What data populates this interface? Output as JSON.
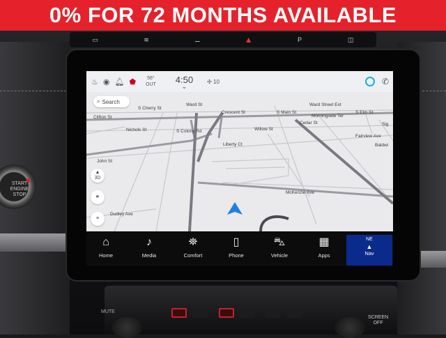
{
  "banner": {
    "text": "0% FOR 72 MONTHS AVAILABLE"
  },
  "status_bar": {
    "temp_value": "56°",
    "temp_label": "OUT",
    "time": "4:50",
    "fan_speed": "10",
    "icons": [
      "seat-heat-icon",
      "driver-profile-icon",
      "bell-icon",
      "uconnect-icon",
      "alexa-icon",
      "phone-icon"
    ]
  },
  "map": {
    "search_label": "Search",
    "btn_3d": "3D",
    "streets": {
      "s_cherry_st": "S Cherry St",
      "ward_st": "Ward St",
      "crescent_st": "Crescent St",
      "s_main_st": "S Main St",
      "ward_street_ext": "Ward Street Ext",
      "clifton_st": "Clifton St",
      "cedar_st": "Cedar St",
      "morningside_ter": "Morningside Ter",
      "s_elm_st": "S Elm St",
      "sig": "Sig",
      "nichols_st": "Nichols St",
      "s_colony_rd": "S Colony Rd",
      "willow_st": "Willow St",
      "fairview_ave": "Fairview Ave",
      "baldwin": "Baldwi",
      "liberty_ct": "Liberty Ct",
      "john_st": "John St",
      "mckenzie_ave": "McKenzie Ave",
      "dudley_ave": "Dudley Ave"
    }
  },
  "nav_bar": {
    "home": "Home",
    "media": "Media",
    "comfort": "Comfort",
    "phone": "Phone",
    "vehicle": "Vehicle",
    "apps": "Apps",
    "nav_direction": "NE",
    "nav": "Nav"
  },
  "console": {
    "mute": "MUTE",
    "screen_off_1": "SCREEN",
    "screen_off_2": "OFF"
  },
  "colors": {
    "banner": "#e5222b",
    "nav_active": "#0a2a8c",
    "position_arrow": "#1f7fe0"
  }
}
